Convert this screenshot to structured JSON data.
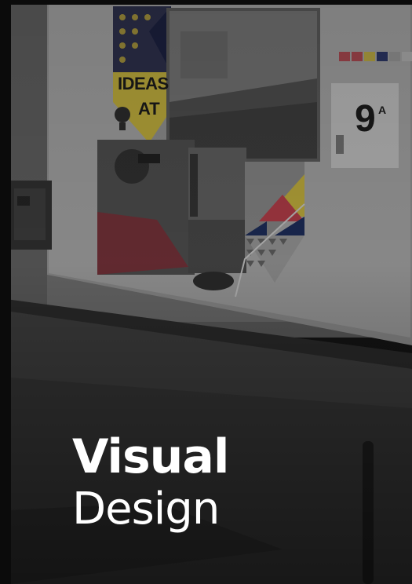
{
  "card": {
    "title_bold": "Visual",
    "title_regular": "Design"
  },
  "poster": {
    "headline_1": "IDEAS",
    "headline_2": "AT",
    "sign_number": "9",
    "sign_letter": "A"
  },
  "colors": {
    "text": "#ffffff",
    "background": "#141414",
    "yellow": "#d9c22a",
    "red": "#b8333f",
    "navy": "#1c2a55"
  }
}
